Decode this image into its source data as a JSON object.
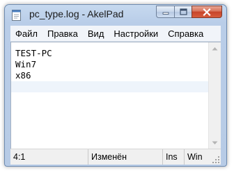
{
  "window": {
    "title": "pc_type.log - AkelPad"
  },
  "menu": {
    "items": [
      {
        "label": "Файл"
      },
      {
        "label": "Правка"
      },
      {
        "label": "Вид"
      },
      {
        "label": "Настройки"
      },
      {
        "label": "Справка"
      }
    ]
  },
  "editor": {
    "lines": [
      "TEST-PC",
      "Win7",
      "x86",
      ""
    ]
  },
  "statusbar": {
    "position": "4:1",
    "modified": "Изменён",
    "insert_mode": "Ins",
    "newline": "Win"
  },
  "icons": {
    "app": "notepad-icon",
    "minimize": "minimize-icon",
    "maximize": "maximize-icon",
    "close": "close-icon",
    "scroll_up": "arrow-up-icon",
    "scroll_down": "arrow-down-icon",
    "grip": "resize-grip-icon"
  },
  "colors": {
    "titlebar": "#b9cde8",
    "close_button": "#c7452a",
    "current_line": "#eef4fb"
  }
}
